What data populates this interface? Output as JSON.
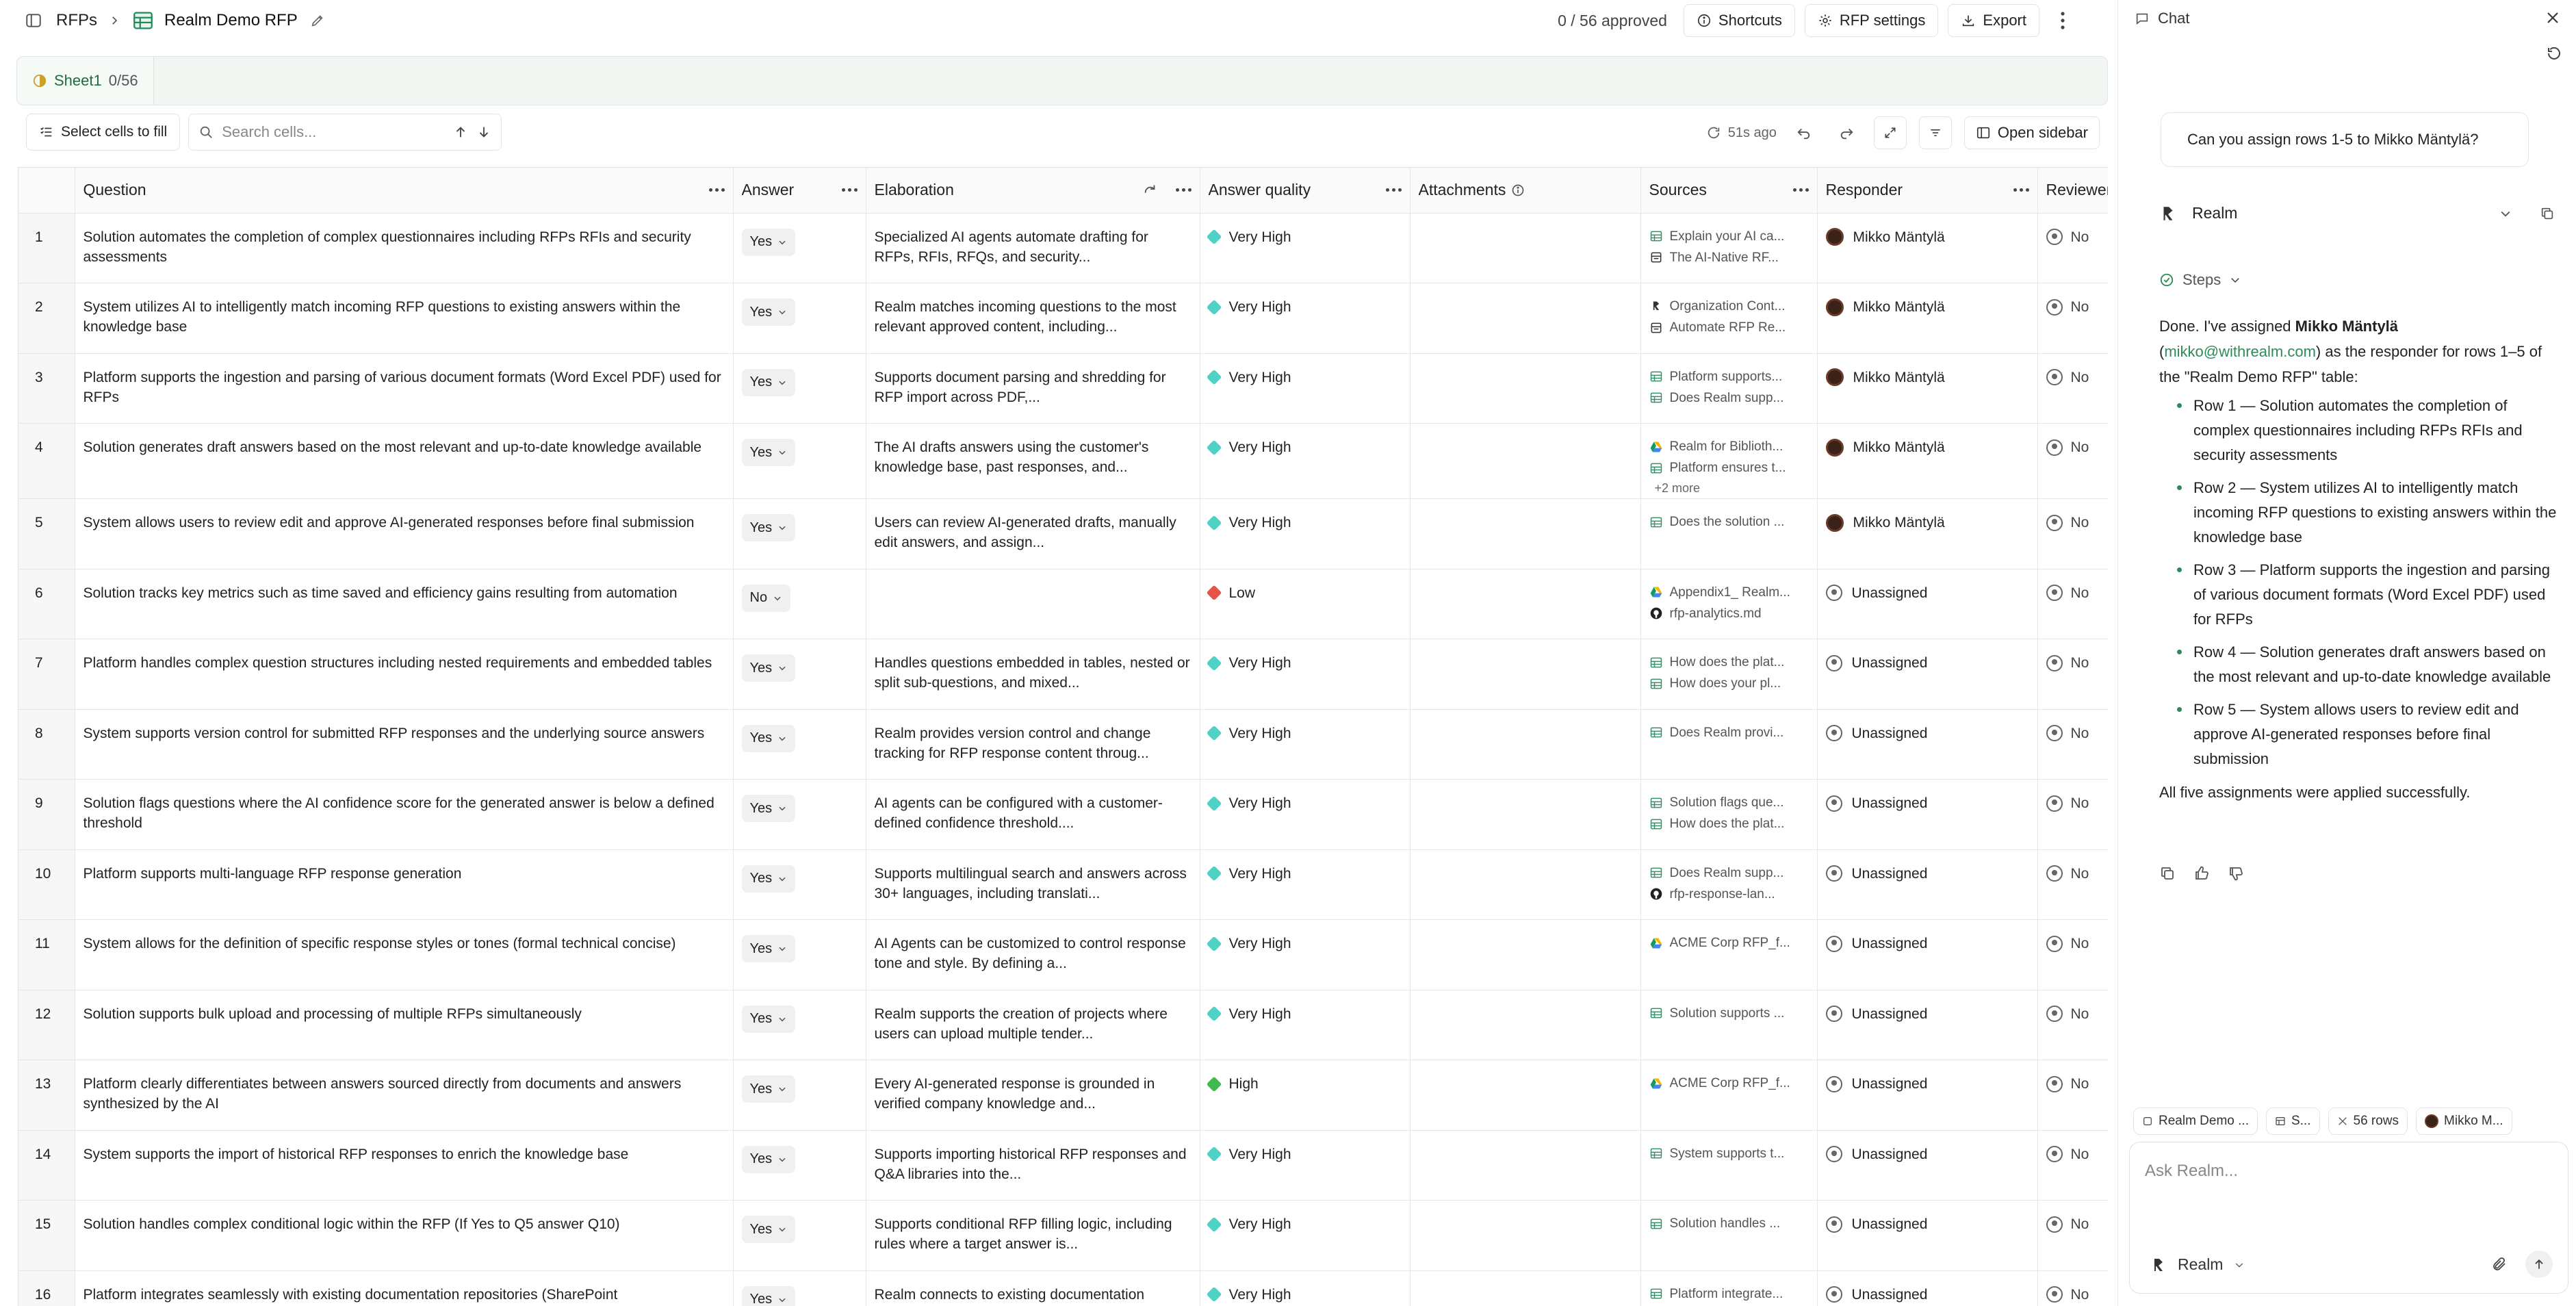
{
  "topbar": {
    "breadcrumb_root": "RFPs",
    "project_title": "Realm Demo RFP",
    "approved_status": "0 / 56 approved",
    "shortcuts_label": "Shortcuts",
    "rfp_settings_label": "RFP settings",
    "export_label": "Export"
  },
  "sheet": {
    "name": "Sheet1",
    "count": "0/56"
  },
  "toolbar": {
    "select_cells_label": "Select cells to fill",
    "search_placeholder": "Search cells...",
    "saved_ago": "51s ago",
    "open_sidebar_label": "Open sidebar"
  },
  "columns": {
    "question": "Question",
    "answer": "Answer",
    "elaboration": "Elaboration",
    "answer_quality": "Answer quality",
    "attachments": "Attachments",
    "sources": "Sources",
    "responder": "Responder",
    "reviewer": "Reviewer"
  },
  "colors": {
    "accent_green": "#2e8b57",
    "very_high": "#4fd1c5",
    "high": "#3fb950",
    "low": "#e5534b"
  },
  "rows": [
    {
      "num": "1",
      "question": "Solution automates the completion of complex questionnaires including RFPs RFIs and security assessments",
      "answer": "Yes",
      "elaboration": "Specialized AI agents automate drafting for RFPs, RFIs, RFQs, and security...",
      "quality": "Very High",
      "sources": [
        {
          "icon": "table-icon",
          "text": "Explain your AI ca..."
        },
        {
          "icon": "doc-icon",
          "text": "The AI-Native RF..."
        }
      ],
      "responder": "Mikko Mäntylä",
      "reviewer": "No"
    },
    {
      "num": "2",
      "question": "System utilizes AI to intelligently match incoming RFP questions to existing answers within the knowledge base",
      "answer": "Yes",
      "elaboration": "Realm matches incoming questions to the most relevant approved content, including...",
      "quality": "Very High",
      "sources": [
        {
          "icon": "org-icon",
          "text": "Organization Cont..."
        },
        {
          "icon": "doc-icon",
          "text": "Automate RFP Re..."
        }
      ],
      "responder": "Mikko Mäntylä",
      "reviewer": "No"
    },
    {
      "num": "3",
      "question": "Platform supports the ingestion and parsing of various document formats (Word Excel PDF) used for RFPs",
      "answer": "Yes",
      "elaboration": "Supports document parsing and shredding for RFP import across PDF,...",
      "quality": "Very High",
      "sources": [
        {
          "icon": "table-icon",
          "text": "Platform supports..."
        },
        {
          "icon": "table-icon",
          "text": "Does Realm supp..."
        }
      ],
      "responder": "Mikko Mäntylä",
      "reviewer": "No"
    },
    {
      "num": "4",
      "question": "Solution generates draft answers based on the most relevant and up-to-date knowledge available",
      "answer": "Yes",
      "elaboration": "The AI drafts answers using the customer's knowledge base, past responses, and...",
      "quality": "Very High",
      "sources": [
        {
          "icon": "drive-icon",
          "text": "Realm for Biblioth..."
        },
        {
          "icon": "table-icon",
          "text": "Platform ensures t..."
        }
      ],
      "more": "+2 more",
      "responder": "Mikko Mäntylä",
      "reviewer": "No"
    },
    {
      "num": "5",
      "question": "System allows users to review edit and approve AI-generated responses before final submission",
      "answer": "Yes",
      "elaboration": "Users can review AI-generated drafts, manually edit answers, and assign...",
      "quality": "Very High",
      "sources": [
        {
          "icon": "table-icon",
          "text": "Does the solution ..."
        }
      ],
      "responder": "Mikko Mäntylä",
      "reviewer": "No"
    },
    {
      "num": "6",
      "question": "Solution tracks key metrics such as time saved and efficiency gains resulting from automation",
      "answer": "No",
      "elaboration": "",
      "quality": "Low",
      "sources": [
        {
          "icon": "drive-icon",
          "text": "Appendix1_ Realm..."
        },
        {
          "icon": "github-icon",
          "text": "rfp-analytics.md"
        }
      ],
      "responder": "Unassigned",
      "reviewer": "No"
    },
    {
      "num": "7",
      "question": "Platform handles complex question structures including nested requirements and embedded tables",
      "answer": "Yes",
      "elaboration": "Handles questions embedded in tables, nested or split sub-questions, and mixed...",
      "quality": "Very High",
      "sources": [
        {
          "icon": "table-icon",
          "text": "How does the plat..."
        },
        {
          "icon": "table-icon",
          "text": "How does your pl..."
        }
      ],
      "responder": "Unassigned",
      "reviewer": "No"
    },
    {
      "num": "8",
      "question": "System supports version control for submitted RFP responses and the underlying source answers",
      "answer": "Yes",
      "elaboration": "Realm provides version control and change tracking for RFP response content throug...",
      "quality": "Very High",
      "sources": [
        {
          "icon": "table-icon",
          "text": "Does Realm provi..."
        }
      ],
      "responder": "Unassigned",
      "reviewer": "No"
    },
    {
      "num": "9",
      "question": "Solution flags questions where the AI confidence score for the generated answer is below a defined threshold",
      "answer": "Yes",
      "elaboration": "AI agents can be configured with a customer-defined confidence threshold....",
      "quality": "Very High",
      "sources": [
        {
          "icon": "table-icon",
          "text": "Solution flags que..."
        },
        {
          "icon": "table-icon",
          "text": "How does the plat..."
        }
      ],
      "responder": "Unassigned",
      "reviewer": "No"
    },
    {
      "num": "10",
      "question": "Platform supports multi-language RFP response generation",
      "answer": "Yes",
      "elaboration": "Supports multilingual search and answers across 30+ languages, including translati...",
      "quality": "Very High",
      "sources": [
        {
          "icon": "table-icon",
          "text": "Does Realm supp..."
        },
        {
          "icon": "github-icon",
          "text": "rfp-response-lan..."
        }
      ],
      "responder": "Unassigned",
      "reviewer": "No"
    },
    {
      "num": "11",
      "question": "System allows for the definition of specific response styles or tones (formal technical concise)",
      "answer": "Yes",
      "elaboration": "AI Agents can be customized to control response tone and style. By defining a...",
      "quality": "Very High",
      "sources": [
        {
          "icon": "drive-icon",
          "text": "ACME Corp RFP_f..."
        }
      ],
      "responder": "Unassigned",
      "reviewer": "No"
    },
    {
      "num": "12",
      "question": "Solution supports bulk upload and processing of multiple RFPs simultaneously",
      "answer": "Yes",
      "elaboration": "Realm supports the creation of projects where users can upload multiple tender...",
      "quality": "Very High",
      "sources": [
        {
          "icon": "table-icon",
          "text": "Solution supports ..."
        }
      ],
      "responder": "Unassigned",
      "reviewer": "No"
    },
    {
      "num": "13",
      "question": "Platform clearly differentiates between answers sourced directly from documents and answers synthesized by the AI",
      "answer": "Yes",
      "elaboration": "Every AI-generated response is grounded in verified company knowledge and...",
      "quality": "High",
      "sources": [
        {
          "icon": "drive-icon",
          "text": "ACME Corp RFP_f..."
        }
      ],
      "responder": "Unassigned",
      "reviewer": "No"
    },
    {
      "num": "14",
      "question": "System supports the import of historical RFP responses to enrich the knowledge base",
      "answer": "Yes",
      "elaboration": "Supports importing historical RFP responses and Q&A libraries into the...",
      "quality": "Very High",
      "sources": [
        {
          "icon": "table-icon",
          "text": "System supports t..."
        }
      ],
      "responder": "Unassigned",
      "reviewer": "No"
    },
    {
      "num": "15",
      "question": "Solution handles complex conditional logic within the RFP (If Yes to Q5 answer Q10)",
      "answer": "Yes",
      "elaboration": "Supports conditional RFP filling logic, including rules where a target answer is...",
      "quality": "Very High",
      "sources": [
        {
          "icon": "table-icon",
          "text": "Solution handles ..."
        }
      ],
      "responder": "Unassigned",
      "reviewer": "No"
    },
    {
      "num": "16",
      "question": "Platform integrates seamlessly with existing documentation repositories (SharePoint",
      "answer": "Yes",
      "elaboration": "Realm connects to existing documentation",
      "quality": "Very High",
      "sources": [
        {
          "icon": "table-icon",
          "text": "Platform integrate..."
        }
      ],
      "responder": "Unassigned",
      "reviewer": "No"
    }
  ],
  "chat": {
    "title": "Chat",
    "user_message": "Can you assign rows 1-5 to Mikko Mäntylä?",
    "assistant_name": "Realm",
    "steps_label": "Steps",
    "msg_done": "Done. I've assigned ",
    "msg_name": "Mikko Mäntylä",
    "msg_open": " (",
    "msg_email": "mikko@withrealm.com",
    "msg_rest": ") as the responder for rows 1–5 of the \"Realm Demo RFP\" table:",
    "items": [
      "Row 1 — Solution automates the completion of complex questionnaires including RFPs RFIs and security assessments",
      "Row 2 — System utilizes AI to intelligently match incoming RFP questions to existing answers within the knowledge base",
      "Row 3 — Platform supports the ingestion and parsing of various document formats (Word Excel PDF) used for RFPs",
      "Row 4 — Solution generates draft answers based on the most relevant and up-to-date knowledge available",
      "Row 5 — System allows users to review edit and approve AI-generated responses before final submission"
    ],
    "closing": "All five assignments were applied successfully.",
    "context_chips": [
      "Realm Demo ...",
      "S...",
      "56 rows",
      "Mikko M..."
    ],
    "input_placeholder": "Ask Realm...",
    "model_label": "Realm"
  }
}
